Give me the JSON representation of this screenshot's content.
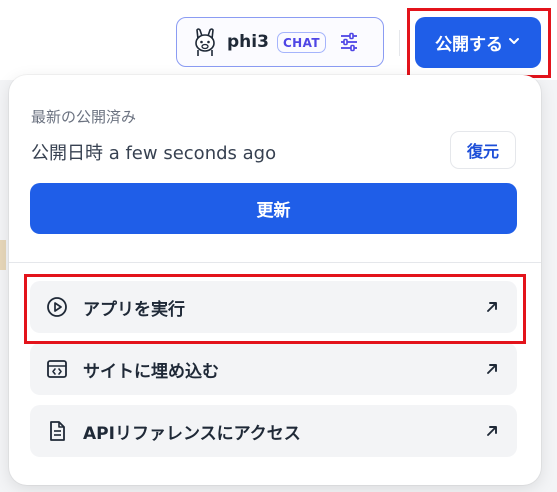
{
  "header": {
    "model": {
      "name": "phi3",
      "badge": "CHAT",
      "avatar_icon": "llama-icon",
      "settings_icon": "sliders-icon"
    },
    "publish_button": {
      "label": "公開する",
      "icon": "chevron-down-icon"
    }
  },
  "publish_panel": {
    "latest_label": "最新の公開済み",
    "published_time": "公開日時 a few seconds ago",
    "restore_label": "復元",
    "update_label": "更新",
    "actions": [
      {
        "label": "アプリを実行",
        "icon": "play-circle-icon",
        "trailing_icon": "arrow-up-right-icon"
      },
      {
        "label": "サイトに埋め込む",
        "icon": "embed-icon",
        "trailing_icon": "arrow-up-right-icon"
      },
      {
        "label": "APIリファレンスにアクセス",
        "icon": "document-icon",
        "trailing_icon": "arrow-up-right-icon"
      }
    ]
  },
  "colors": {
    "primary": "#1f5ee8",
    "highlight": "#e3131b",
    "chip_border": "#8b9cf3",
    "badge_text": "#4f46e5"
  }
}
